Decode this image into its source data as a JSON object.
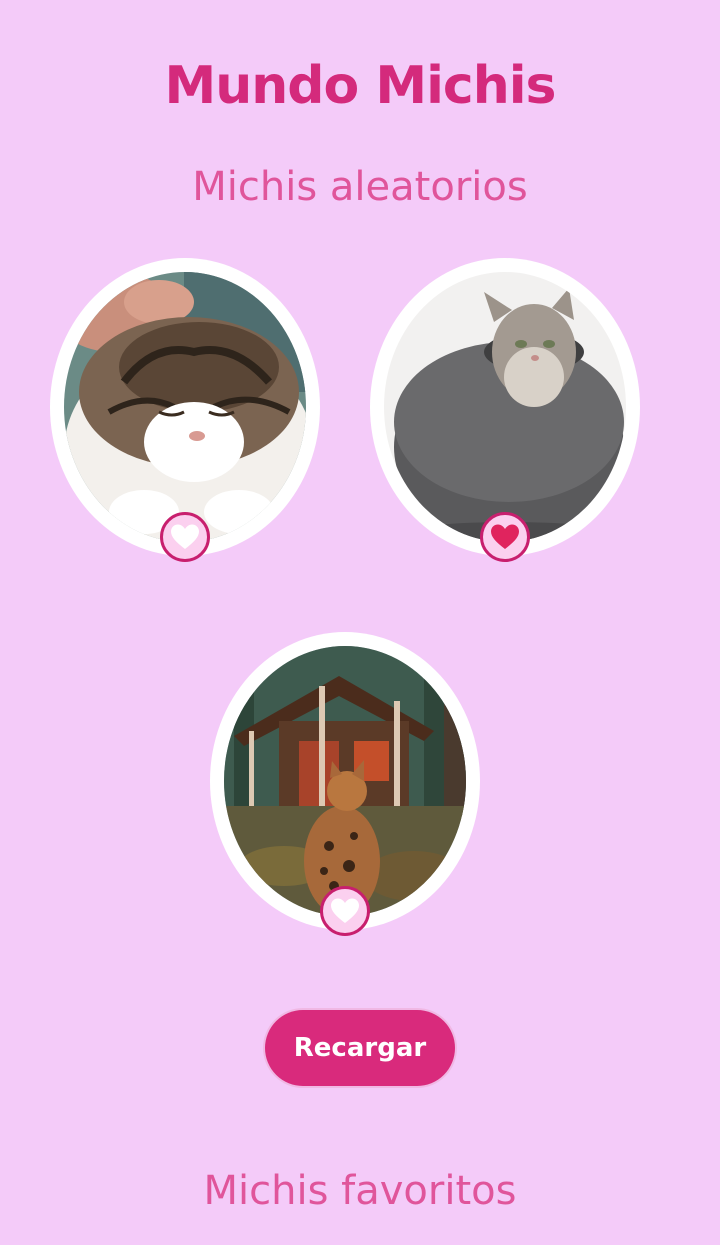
{
  "app": {
    "title": "Mundo Michis"
  },
  "random_section": {
    "title": "Michis aleatorios",
    "cats": [
      {
        "photo": "scottish-fold-cat-being-petted",
        "favorited": false
      },
      {
        "photo": "gray-cat-in-felt-cat-cave",
        "favorited": true
      },
      {
        "photo": "bengal-cat-in-front-of-cabin",
        "favorited": false
      }
    ]
  },
  "reload_button": {
    "label": "Recargar"
  },
  "favorites_section": {
    "title": "Michis favoritos"
  },
  "colors": {
    "background": "#f4cbf9",
    "title": "#d42a7c",
    "subtitle": "#e0559b",
    "button": "#d92a7c",
    "heart_active": "#e0245e",
    "heart_inactive": "#ffffff"
  }
}
